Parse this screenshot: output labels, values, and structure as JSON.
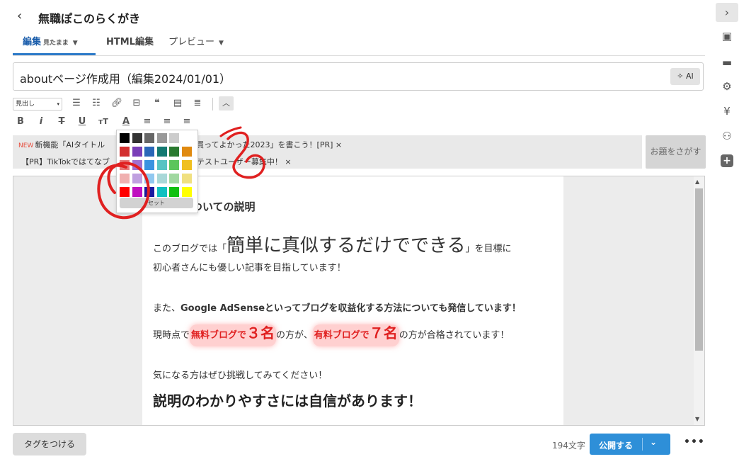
{
  "header": {
    "back_icon": "chevron-left-icon",
    "blog_title": "無職ぽこのらくがき"
  },
  "tabs": [
    {
      "label": "編集",
      "sub": "見たまま",
      "chev": "⌄"
    },
    {
      "label": "HTML編集"
    },
    {
      "label": "プレビュー",
      "chev": "⌄"
    }
  ],
  "title_input": {
    "value": "aboutページ作成用（編集2024/01/01）",
    "ai_label": "✧ AI"
  },
  "toolbar": {
    "heading_select": "見出し",
    "row1_icons": [
      "ul-icon",
      "ol-icon",
      "link-icon",
      "hr-icon",
      "quote-icon",
      "table-icon",
      "align-icon"
    ],
    "row2_icons": [
      "bold-icon",
      "italic-icon",
      "strike-icon",
      "underline-icon",
      "fontsize-icon",
      "fontcolor-icon",
      "align-left-icon",
      "align-center-icon",
      "align-right-icon"
    ],
    "row2_glyphs": [
      "B",
      "i",
      "T",
      "U",
      "тT",
      "A",
      "≡",
      "≡",
      "≡"
    ]
  },
  "notice": {
    "new_tag": "NEW",
    "line1": "新機能「AIタイトル…「買ってよかった2023」を書こう！[PR] ×",
    "line1_a": "新機能「AIタイトル",
    "line1_b": "「買ってよかった2023」を書こう！[PR]",
    "line2_a": "【PR】TikTokではてなブ",
    "line2_b": "るテストユーザー募集中！",
    "close": "×",
    "odai_button": "お題をさがす"
  },
  "editor": {
    "heading_about": "についての説明",
    "p1_a": "このブログでは「",
    "p1_big": "簡単に真似するだけでできる",
    "p1_b": "」を目標に",
    "p2": "初心者さんにも優しい記事を目指しています！",
    "p3_a": "また、",
    "p3_b": "Google AdSenseといってブログを収益化する方法についても発信しています！",
    "p4_a": "現時点で",
    "p4_hl1": "無料ブログで",
    "p4_num1": "３名",
    "p4_b": "の方が、",
    "p4_hl2": "有料ブログで",
    "p4_num2": "７名",
    "p4_c": "の方が合格されています！",
    "p5": "気になる方はぜひ挑戦してみてください！",
    "h_big": "説明のわかりやすさには自信があります！"
  },
  "palette": {
    "reset_label": "セット",
    "rows": [
      [
        "#000000",
        "#333333",
        "#666666",
        "#999999",
        "#cccccc"
      ],
      [
        "#d33030",
        "#7a3fb8",
        "#2a67b8",
        "#147a72",
        "#2a7a30",
        "#e08a10"
      ],
      [
        "#e67a7a",
        "#a06fd0",
        "#3a92e0",
        "#57c3c3",
        "#5cc55c",
        "#f0c020"
      ],
      [
        "#f0b0b0",
        "#c0a0e0",
        "#90c8f0",
        "#a8d8d8",
        "#a0d8a0",
        "#f0e080"
      ],
      [
        "#ff0000",
        "#c010c0",
        "#1a1aa0",
        "#10c0c0",
        "#10c010",
        "#ffff00"
      ]
    ]
  },
  "footer": {
    "tag_button": "タグをつける",
    "char_count": "194文字",
    "publish_label": "公開する",
    "publish_arrow": "⌄",
    "more": "•••"
  },
  "rail": {
    "collapse_icon": "chevron-right-icon",
    "icons": [
      "image-icon",
      "folder-icon",
      "gear-icon",
      "yen-icon",
      "users-icon",
      "plus-icon"
    ]
  },
  "colors": {
    "accent": "#2e8fd8",
    "annotation_red": "#e02020"
  }
}
